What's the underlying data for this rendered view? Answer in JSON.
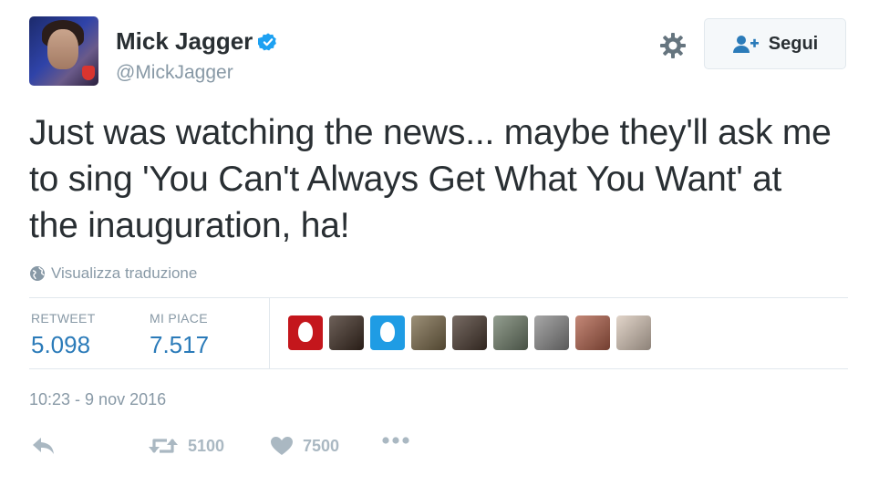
{
  "user": {
    "display_name": "Mick Jagger",
    "handle": "@MickJagger",
    "verified": true
  },
  "follow_button": {
    "label": "Segui"
  },
  "tweet": {
    "text": "Just was watching the news... maybe they'll ask me to sing 'You Can't Always Get What You Want' at the inauguration, ha!",
    "translate_label": "Visualizza traduzione",
    "timestamp": "10:23 - 9 nov 2016"
  },
  "stats": {
    "retweets_label": "RETWEET",
    "retweets_value": "5.098",
    "likes_label": "MI PIACE",
    "likes_value": "7.517"
  },
  "actions": {
    "retweet_count": "5100",
    "like_count": "7500"
  },
  "colors": {
    "link_blue": "#2b7bb9",
    "verified_blue": "#1da1f2",
    "muted": "#8899a6",
    "icon_gray": "#aab8c2"
  },
  "likers": [
    {
      "icon": "egg-avatar",
      "color": "#c4161c"
    },
    {
      "icon": "photo-avatar",
      "color": "#3d2c22"
    },
    {
      "icon": "egg-avatar",
      "color": "#1f9ce4"
    },
    {
      "icon": "photo-avatar",
      "color": "#7b6a4a"
    },
    {
      "icon": "photo-avatar",
      "color": "#4a3a30"
    },
    {
      "icon": "photo-avatar",
      "color": "#6f7d6a"
    },
    {
      "icon": "photo-avatar",
      "color": "#8a8a8a"
    },
    {
      "icon": "photo-avatar",
      "color": "#b0604a"
    },
    {
      "icon": "photo-avatar",
      "color": "#d8c7b8"
    }
  ]
}
